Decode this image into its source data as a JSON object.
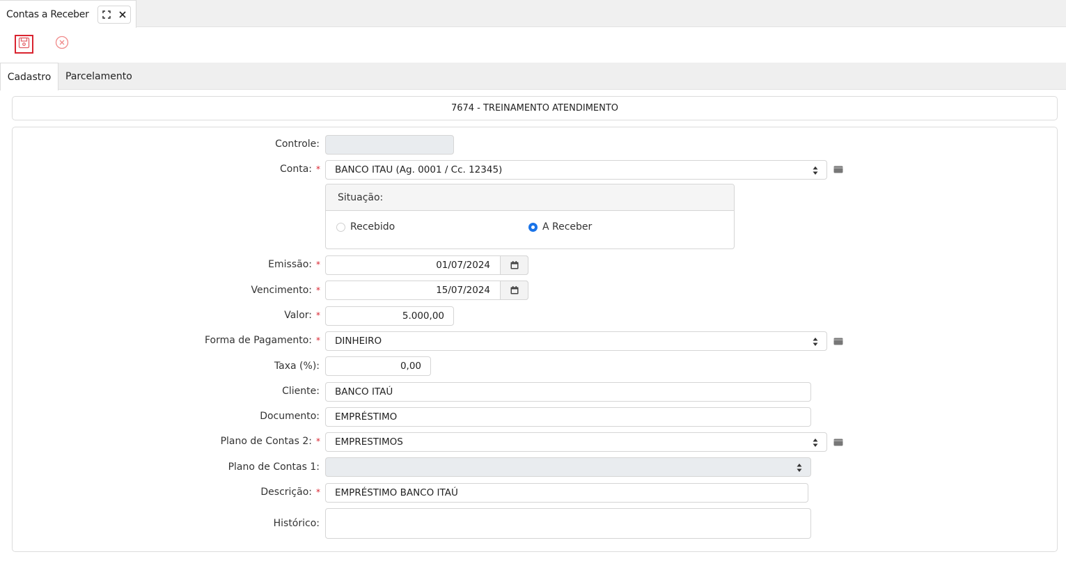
{
  "window_tab": {
    "title": "Contas a Receber",
    "maximize_icon": "expand-icon",
    "close_icon": "close-icon"
  },
  "toolbar": {
    "save_icon": "save-icon",
    "cancel_icon": "cancel-circle-icon"
  },
  "form_tabs": [
    {
      "label": "Cadastro",
      "active": true
    },
    {
      "label": "Parcelamento",
      "active": false
    }
  ],
  "header": {
    "title": "7674 - TREINAMENTO ATENDIMENTO"
  },
  "form": {
    "controle": {
      "label": "Controle:",
      "value": ""
    },
    "conta": {
      "label": "Conta:",
      "value": "BANCO ITAU (Ag. 0001 / Cc. 12345)"
    },
    "situacao": {
      "label": "Situação:",
      "options": [
        {
          "label": "Recebido",
          "checked": false
        },
        {
          "label": "A Receber",
          "checked": true
        }
      ]
    },
    "emissao": {
      "label": "Emissão:",
      "value": "01/07/2024"
    },
    "vencimento": {
      "label": "Vencimento:",
      "value": "15/07/2024"
    },
    "valor": {
      "label": "Valor:",
      "value": "5.000,00"
    },
    "forma_pagamento": {
      "label": "Forma de Pagamento:",
      "value": "DINHEIRO"
    },
    "taxa": {
      "label": "Taxa (%):",
      "value": "0,00"
    },
    "cliente": {
      "label": "Cliente:",
      "value": "BANCO ITAÚ"
    },
    "documento": {
      "label": "Documento:",
      "value": "EMPRÉSTIMO"
    },
    "plano_contas_2": {
      "label": "Plano de Contas 2:",
      "value": "EMPRESTIMOS"
    },
    "plano_contas_1": {
      "label": "Plano de Contas 1:",
      "value": ""
    },
    "descricao": {
      "label": "Descrição:",
      "value": "EMPRÉSTIMO BANCO ITAÚ"
    },
    "historico": {
      "label": "Histórico:",
      "value": ""
    },
    "required_mark": "*"
  },
  "colors": {
    "accent": "#1a73e8",
    "required": "#d9232f",
    "cancel": "#f08080"
  }
}
